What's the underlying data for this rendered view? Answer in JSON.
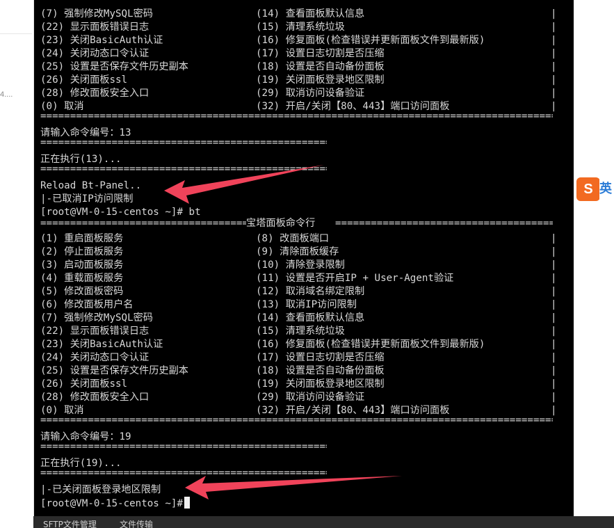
{
  "left_snippet": "4....",
  "prompt": "[root@VM-0-15-centos ~]#",
  "bt_command": "bt",
  "separator": "================================================================================================================",
  "separator_short": "==========================================================",
  "menu_title": "宝塔面板命令行",
  "menu_top_partial": [
    {
      "left": "(7) 强制修改MySQL密码",
      "right": "(14) 查看面板默认信息"
    },
    {
      "left": "(22) 显示面板错误日志",
      "right": "(15) 清理系统垃圾"
    },
    {
      "left": "(23) 关闭BasicAuth认证",
      "right": "(16) 修复面板(检查错误并更新面板文件到最新版)"
    },
    {
      "left": "(24) 关闭动态口令认证",
      "right": "(17) 设置日志切割是否压缩"
    },
    {
      "left": "(25) 设置是否保存文件历史副本",
      "right": "(18) 设置是否自动备份面板"
    },
    {
      "left": "(26) 关闭面板ssl",
      "right": "(19) 关闭面板登录地区限制"
    },
    {
      "left": "(28) 修改面板安全入口",
      "right": "(29) 取消访问设备验证"
    },
    {
      "left": "(0) 取消",
      "right": "(32) 开启/关闭【80、443】端口访问面板"
    }
  ],
  "menu_full": [
    {
      "left": "(1) 重启面板服务",
      "right": "(8) 改面板端口"
    },
    {
      "left": "(2) 停止面板服务",
      "right": "(9) 清除面板缓存"
    },
    {
      "left": "(3) 启动面板服务",
      "right": "(10) 清除登录限制"
    },
    {
      "left": "(4) 重载面板服务",
      "right": "(11) 设置是否开启IP + User-Agent验证"
    },
    {
      "left": "(5) 修改面板密码",
      "right": "(12) 取消域名绑定限制"
    },
    {
      "left": "(6) 修改面板用户名",
      "right": "(13) 取消IP访问限制"
    },
    {
      "left": "(7) 强制修改MySQL密码",
      "right": "(14) 查看面板默认信息"
    },
    {
      "left": "(22) 显示面板错误日志",
      "right": "(15) 清理系统垃圾"
    },
    {
      "left": "(23) 关闭BasicAuth认证",
      "right": "(16) 修复面板(检查错误并更新面板文件到最新版)"
    },
    {
      "left": "(24) 关闭动态口令认证",
      "right": "(17) 设置日志切割是否压缩"
    },
    {
      "left": "(25) 设置是否保存文件历史副本",
      "right": "(18) 设置是否自动备份面板"
    },
    {
      "left": "(26) 关闭面板ssl",
      "right": "(19) 关闭面板登录地区限制"
    },
    {
      "left": "(28) 修改面板安全入口",
      "right": "(29) 取消访问设备验证"
    },
    {
      "left": "(0) 取消",
      "right": "(32) 开启/关闭【80、443】端口访问面板"
    }
  ],
  "session1": {
    "input": "请输入命令编号：13",
    "executing": "正在执行(13)...",
    "reload": "Reload Bt-Panel..",
    "result": "|-已取消IP访问限制"
  },
  "session2": {
    "input": "请输入命令编号：19",
    "executing": "正在执行(19)...",
    "result": "|-已关闭面板登录地区限制"
  },
  "ime_label": "S",
  "ime_partial": "英",
  "bottom_tabs": [
    "SFTP文件管理",
    "文件传输"
  ],
  "colors": {
    "terminal_bg": "#000000",
    "terminal_fg": "#d8d8d8",
    "arrow": "#f0435a",
    "sogou_brand": "#f26a21"
  }
}
